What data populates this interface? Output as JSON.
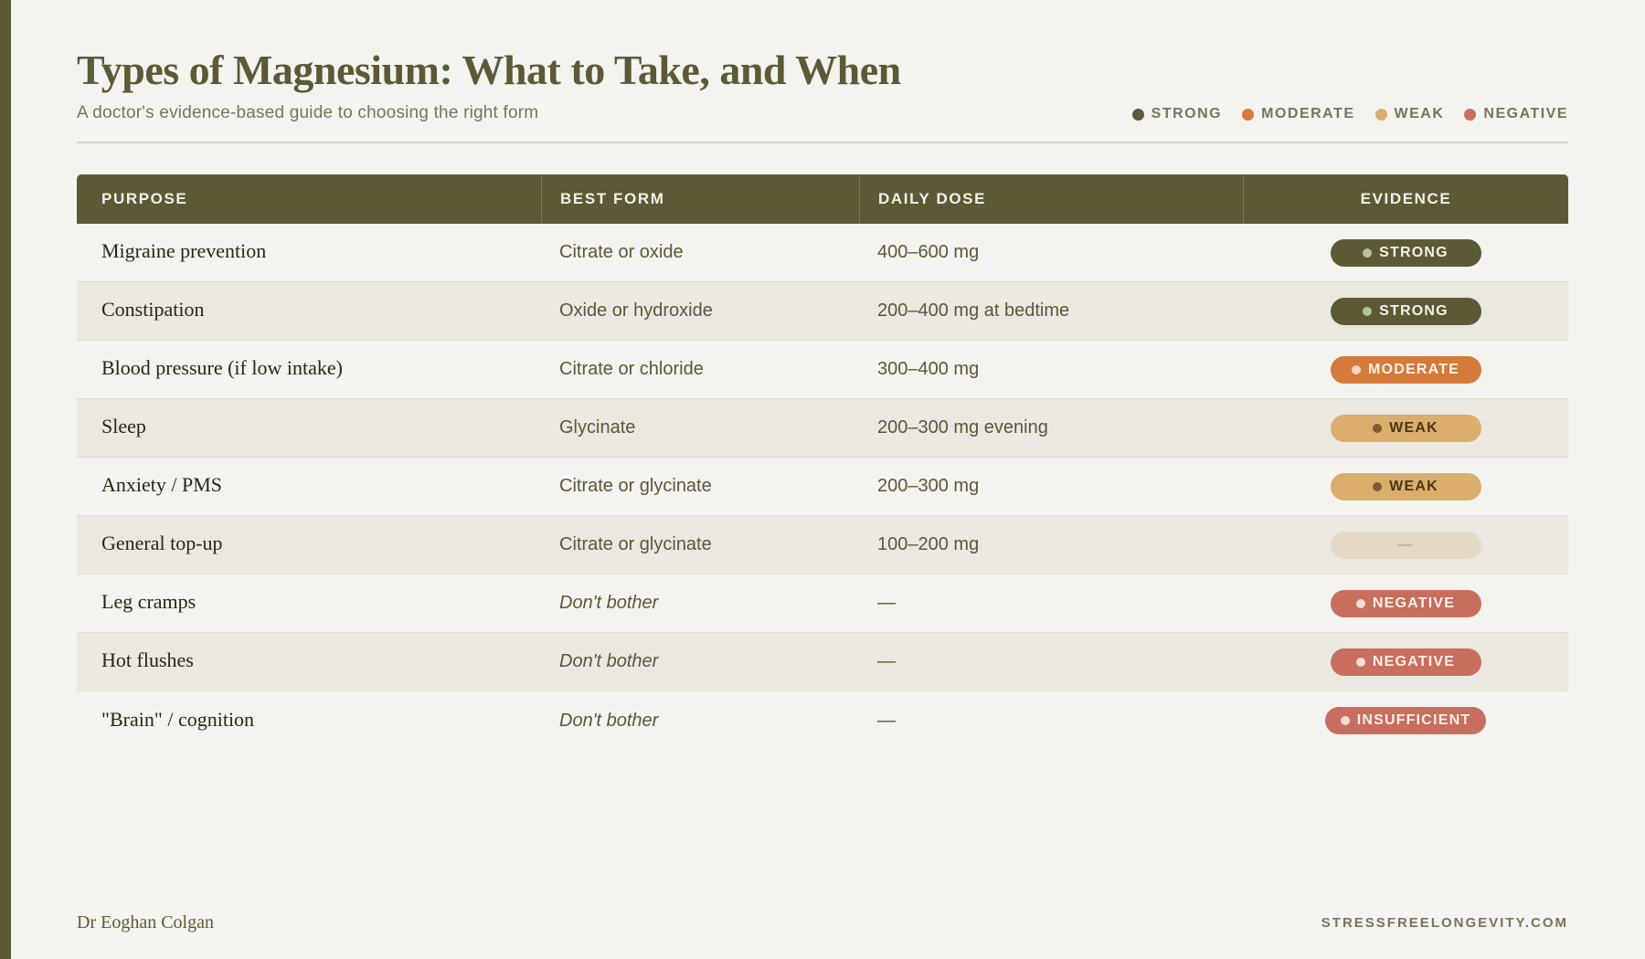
{
  "header": {
    "title": "Types of Magnesium: What to Take, and When",
    "subtitle": "A doctor's evidence-based guide to choosing the right form"
  },
  "legend": [
    {
      "label": "STRONG",
      "color": "#5c5a36"
    },
    {
      "label": "MODERATE",
      "color": "#d47a3a"
    },
    {
      "label": "WEAK",
      "color": "#dbae6d"
    },
    {
      "label": "NEGATIVE",
      "color": "#c86e5e"
    }
  ],
  "table": {
    "columns": [
      "PURPOSE",
      "BEST FORM",
      "DAILY DOSE",
      "EVIDENCE"
    ],
    "rows": [
      {
        "purpose": "Migraine prevention",
        "form": "Citrate or oxide",
        "dose": "400–600 mg",
        "evidence": "STRONG",
        "level": "strong"
      },
      {
        "purpose": "Constipation",
        "form": "Oxide or hydroxide",
        "dose": "200–400 mg at bedtime",
        "evidence": "STRONG",
        "level": "strong"
      },
      {
        "purpose": "Blood pressure (if low intake)",
        "form": "Citrate or chloride",
        "dose": "300–400 mg",
        "evidence": "MODERATE",
        "level": "moderate"
      },
      {
        "purpose": "Sleep",
        "form": "Glycinate",
        "dose": "200–300 mg evening",
        "evidence": "WEAK",
        "level": "weak"
      },
      {
        "purpose": "Anxiety / PMS",
        "form": "Citrate or glycinate",
        "dose": "200–300 mg",
        "evidence": "WEAK",
        "level": "weak"
      },
      {
        "purpose": "General top-up",
        "form": "Citrate or glycinate",
        "dose": "100–200 mg",
        "evidence": "—",
        "level": "none"
      },
      {
        "purpose": "Leg cramps",
        "form": "Don't bother",
        "dose": "—",
        "evidence": "NEGATIVE",
        "level": "negative"
      },
      {
        "purpose": "Hot flushes",
        "form": "Don't bother",
        "dose": "—",
        "evidence": "NEGATIVE",
        "level": "negative"
      },
      {
        "purpose": "\"Brain\" / cognition",
        "form": "Don't bother",
        "dose": "—",
        "evidence": "INSUFFICIENT",
        "level": "insufficient"
      }
    ]
  },
  "footer": {
    "author": "Dr Eoghan Colgan",
    "website": "STRESSFREELONGEVITY.COM"
  }
}
